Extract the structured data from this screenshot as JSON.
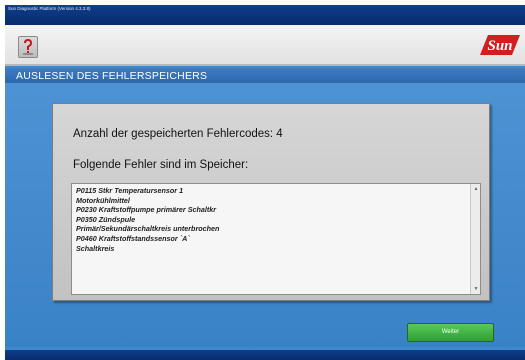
{
  "window": {
    "title": "Sun Diagnostic Platform (Version 4.3.3.8)"
  },
  "header": {
    "help_icon": "question-mark-icon",
    "logo_text": "Sun"
  },
  "section": {
    "title": "AUSLESEN DES FEHLERSPEICHERS"
  },
  "panel": {
    "count_label": "Anzahl der gespeicherten Fehlercodes:",
    "count_value": "4",
    "list_heading": "Folgende Fehler sind im Speicher:",
    "fault_lines": [
      "P0115 Stkr Temperatursensor 1",
      " Motorkühlmittel",
      "P0230 Kraftstoffpumpe primärer Schaltkr",
      "P0350 Zündspule",
      " Primär/Sekundärschaltkreis unterbrochen",
      "P0460 Kraftstoffstandssensor `A`",
      " Schaltkreis"
    ]
  },
  "actions": {
    "weiter_label": "Weiter"
  },
  "colors": {
    "title_bar": "#0f3f8c",
    "section_bar": "#2c67ac",
    "background": "#3f88cf",
    "panel": "#cfcfcf",
    "button_green": "#3fb046",
    "logo_red": "#d21e1e"
  }
}
